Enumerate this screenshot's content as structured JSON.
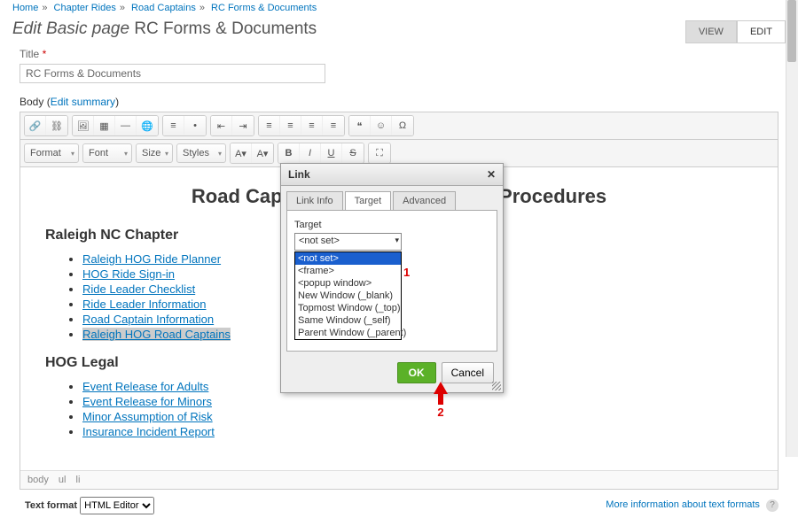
{
  "breadcrumb": {
    "items": [
      "Home",
      "Chapter Rides",
      "Road Captains",
      "RC Forms & Documents"
    ]
  },
  "page_title": {
    "prefix": "Edit Basic page",
    "name": "RC Forms & Documents"
  },
  "tabs": {
    "view": "VIEW",
    "edit": "EDIT"
  },
  "title_field": {
    "label": "Title",
    "required": "*",
    "value": "RC Forms & Documents"
  },
  "body_field": {
    "label": "Body",
    "edit_summary": "Edit summary"
  },
  "toolbar_dd": {
    "format": "Format",
    "font": "Font",
    "size": "Size",
    "styles": "Styles"
  },
  "content": {
    "heading": "Road Captain Forms/Documents/Procedures",
    "section1": "Raleigh NC Chapter",
    "list1": [
      "Raleigh HOG Ride Planner",
      "HOG Ride Sign-in",
      "Ride Leader Checklist",
      "Ride Leader Information",
      "Road Captain Information",
      "Raleigh HOG Road Captains"
    ],
    "section2": "HOG Legal",
    "list2": [
      "Event Release for Adults",
      "Event Release for Minors",
      "Minor Assumption of Risk",
      "Insurance Incident Report"
    ]
  },
  "path": {
    "body": "body",
    "ul": "ul",
    "li": "li"
  },
  "text_format": {
    "label": "Text format",
    "value": "HTML Editor",
    "more_info": "More information about text formats"
  },
  "dialog": {
    "title": "Link",
    "tabs": {
      "info": "Link Info",
      "target": "Target",
      "advanced": "Advanced"
    },
    "target_label": "Target",
    "selected": "<not set>",
    "options": [
      "<not set>",
      "<frame>",
      "<popup window>",
      "New Window (_blank)",
      "Topmost Window (_top)",
      "Same Window (_self)",
      "Parent Window (_parent)"
    ],
    "ok": "OK",
    "cancel": "Cancel"
  },
  "annotations": {
    "a1": "1",
    "a2": "2"
  }
}
